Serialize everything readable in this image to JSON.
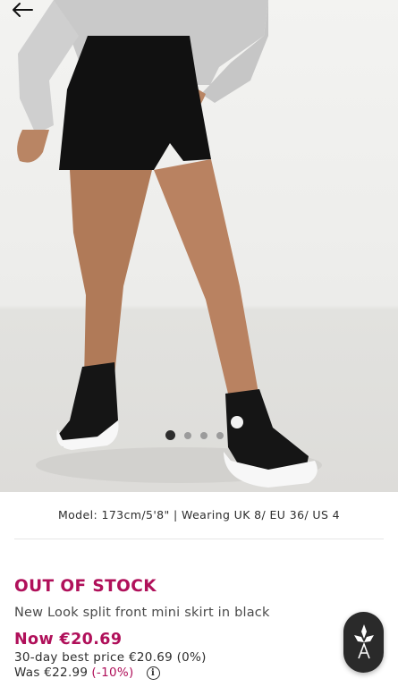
{
  "image": {
    "alt": "New Look split front mini skirt in black",
    "gallery_count": 4,
    "active_index": 0
  },
  "model_info": "Model: 173cm/5'8\" | Wearing UK 8/ EU 36/ US 4",
  "product": {
    "stock_status": "OUT OF STOCK",
    "name": "New Look split front mini skirt in black",
    "now_price": "Now €20.69",
    "best_price": "30-day best price €20.69 (0%)",
    "was_price": "Was €22.99",
    "discount": "(-10%)"
  },
  "colors": {
    "accent": "#b0105a",
    "text": "#2d2d2d",
    "fab": "#2a2a2a"
  },
  "icons": {
    "back": "arrow-left-icon",
    "info": "info-icon",
    "fab": "style-assistant-icon"
  }
}
